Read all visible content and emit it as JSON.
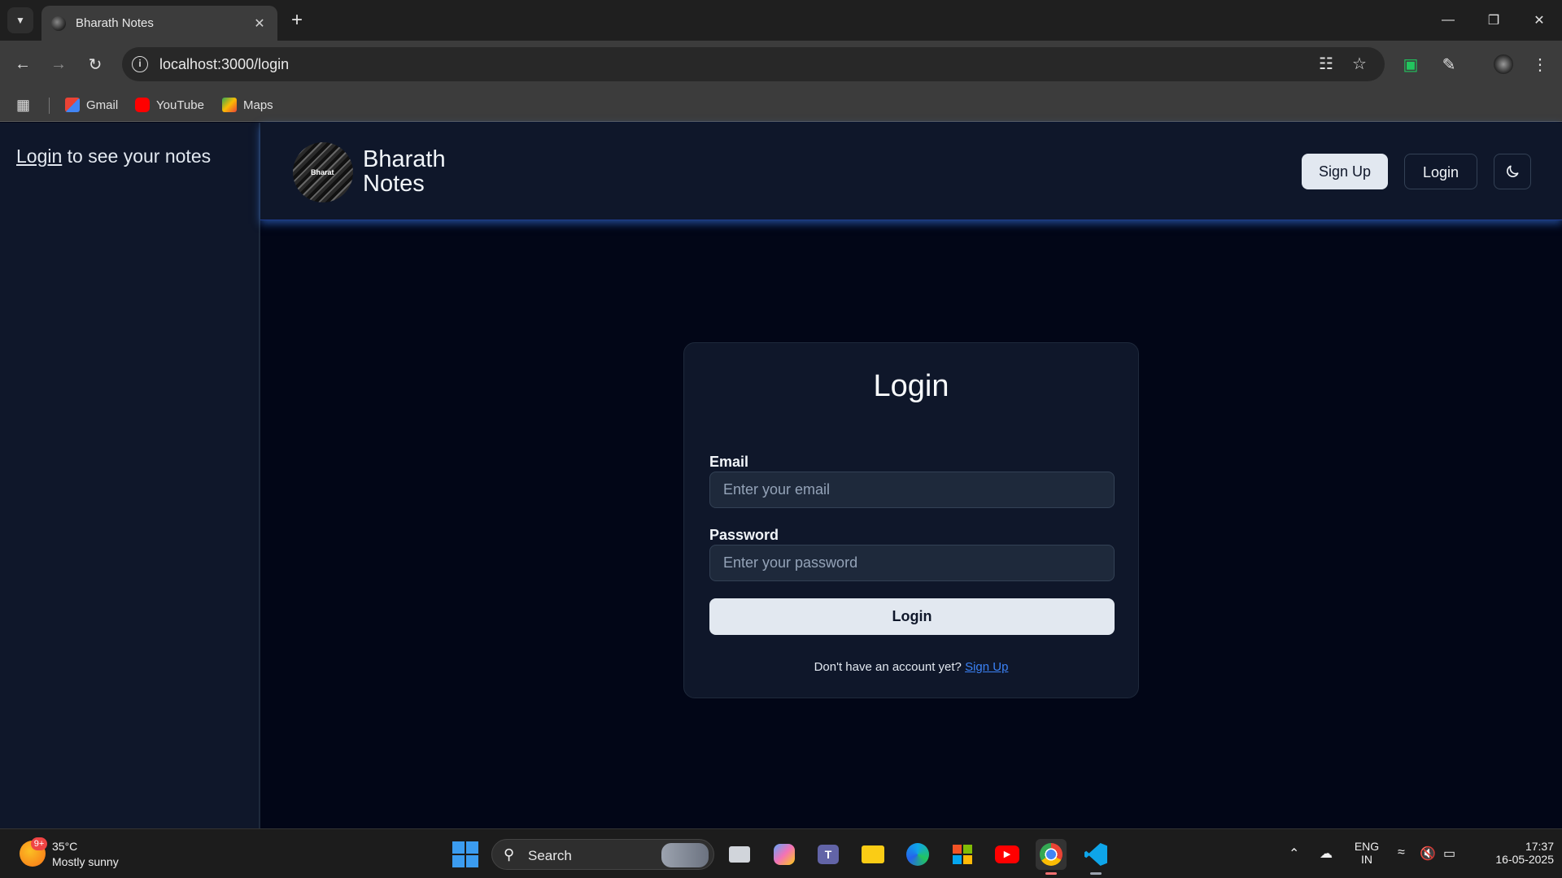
{
  "browser": {
    "tab_title": "Bharath Notes",
    "url": "localhost:3000/login",
    "bookmarks": [
      "Gmail",
      "YouTube",
      "Maps"
    ]
  },
  "sidebar": {
    "login_link": "Login",
    "message_rest": " to see your notes"
  },
  "header": {
    "logo_text": "Bharat",
    "brand_line1": "Bharath",
    "brand_line2": "Notes",
    "signup_label": "Sign Up",
    "login_label": "Login",
    "theme_icon": "moon-icon"
  },
  "login_form": {
    "title": "Login",
    "email_label": "Email",
    "email_placeholder": "Enter your email",
    "password_label": "Password",
    "password_placeholder": "Enter your password",
    "submit_label": "Login",
    "footer_text": "Don't have an account yet? ",
    "footer_link": "Sign Up"
  },
  "taskbar": {
    "weather_badge": "9+",
    "weather_temp": "35°C",
    "weather_desc": "Mostly sunny",
    "search_label": "Search",
    "language_line1": "ENG",
    "language_line2": "IN",
    "time": "17:37",
    "date": "16-05-2025"
  },
  "colors": {
    "page_bg": "#020617",
    "panel_bg": "#0f172a",
    "accent_link": "#3b82f6",
    "primary_button": "#e2e8f0"
  }
}
